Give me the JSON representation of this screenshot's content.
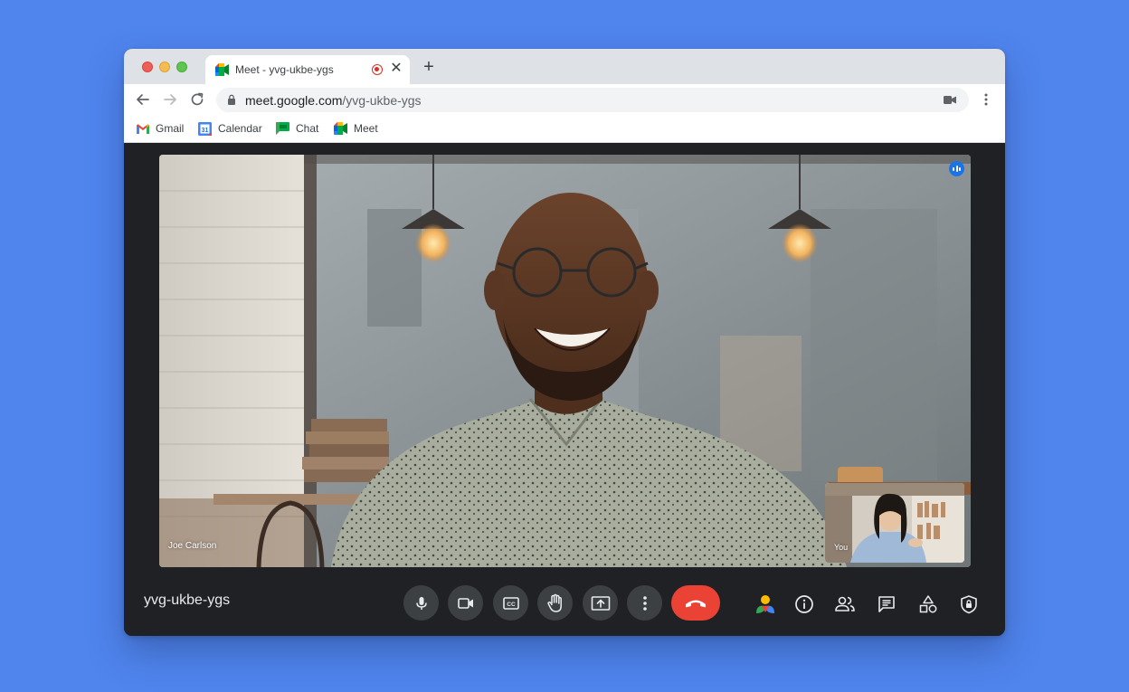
{
  "browser": {
    "tab": {
      "title": "Meet - yvg-ukbe-ygs",
      "close": "✕"
    },
    "new_tab": "+",
    "address": {
      "host": "meet.google.com",
      "path": "/yvg-ukbe-ygs"
    },
    "bookmarks": [
      {
        "label": "Gmail",
        "icon": "gmail-icon"
      },
      {
        "label": "Calendar",
        "icon": "calendar-icon",
        "badge": "31"
      },
      {
        "label": "Chat",
        "icon": "chat-icon"
      },
      {
        "label": "Meet",
        "icon": "meet-icon"
      }
    ]
  },
  "meeting": {
    "code": "yvg-ukbe-ygs",
    "main_participant": "Joe Carlson",
    "self_label": "You"
  },
  "controls": [
    "microphone-icon",
    "camera-icon",
    "captions-icon",
    "raise-hand-icon",
    "present-icon",
    "more-options-icon",
    "hang-up-icon"
  ],
  "side_controls": [
    "effects-icon",
    "info-icon",
    "people-icon",
    "chat-icon",
    "activities-icon",
    "host-controls-icon"
  ],
  "colors": {
    "background": "#5085ee",
    "stage": "#202124",
    "control": "#3c4043",
    "hangup": "#ea4335",
    "speaking": "#1a73e8"
  }
}
